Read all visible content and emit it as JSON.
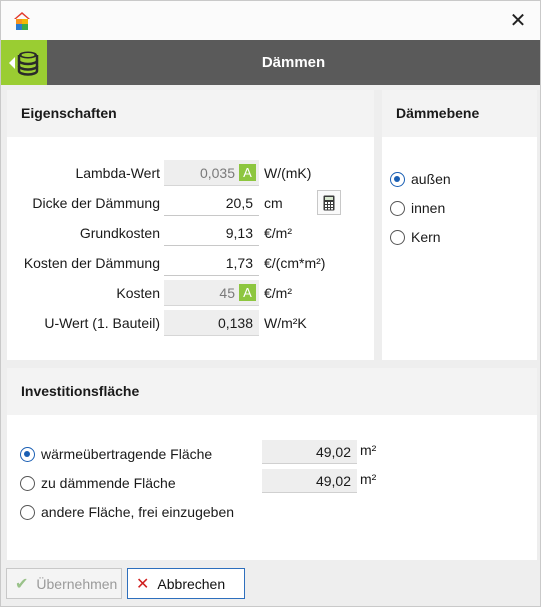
{
  "window": {
    "close_glyph": "✕"
  },
  "header": {
    "title": "Dämmen",
    "icon": "database-icon"
  },
  "eigenschaften": {
    "title": "Eigenschaften",
    "rows": [
      {
        "label": "Lambda-Wert",
        "value": "0,035",
        "unit": "W/(mK)",
        "badge": "A"
      },
      {
        "label": "Dicke der Dämmung",
        "value": "20,5",
        "unit": "cm"
      },
      {
        "label": "Grundkosten",
        "value": "9,13",
        "unit": "€/m²"
      },
      {
        "label": "Kosten der Dämmung",
        "value": "1,73",
        "unit": "€/(cm*m²)"
      },
      {
        "label": "Kosten",
        "value": "45",
        "unit": "€/m²",
        "badge": "A"
      },
      {
        "label": "U-Wert (1. Bauteil)",
        "value": "0,138",
        "unit": "W/m²K"
      }
    ]
  },
  "daemmebene": {
    "title": "Dämmebene",
    "options": [
      "außen",
      "innen",
      "Kern"
    ],
    "selected": "außen"
  },
  "investitionsflaeche": {
    "title": "Investitionsfläche",
    "options": [
      {
        "label": "wärmeübertragende Fläche",
        "value": "49,02",
        "unit": "m²"
      },
      {
        "label": "zu dämmende Fläche",
        "value": "49,02",
        "unit": "m²"
      },
      {
        "label": "andere Fläche, frei einzugeben"
      }
    ],
    "selected": "wärmeübertragende Fläche"
  },
  "footer": {
    "ok_label": "Übernehmen",
    "cancel_label": "Abbrechen"
  },
  "colors": {
    "accent_green": "#9acd32",
    "badge_green": "#8dc63f",
    "banner_gray": "#5a5a5a",
    "radio_blue": "#1a5fb4",
    "cancel_red": "#d02020"
  }
}
